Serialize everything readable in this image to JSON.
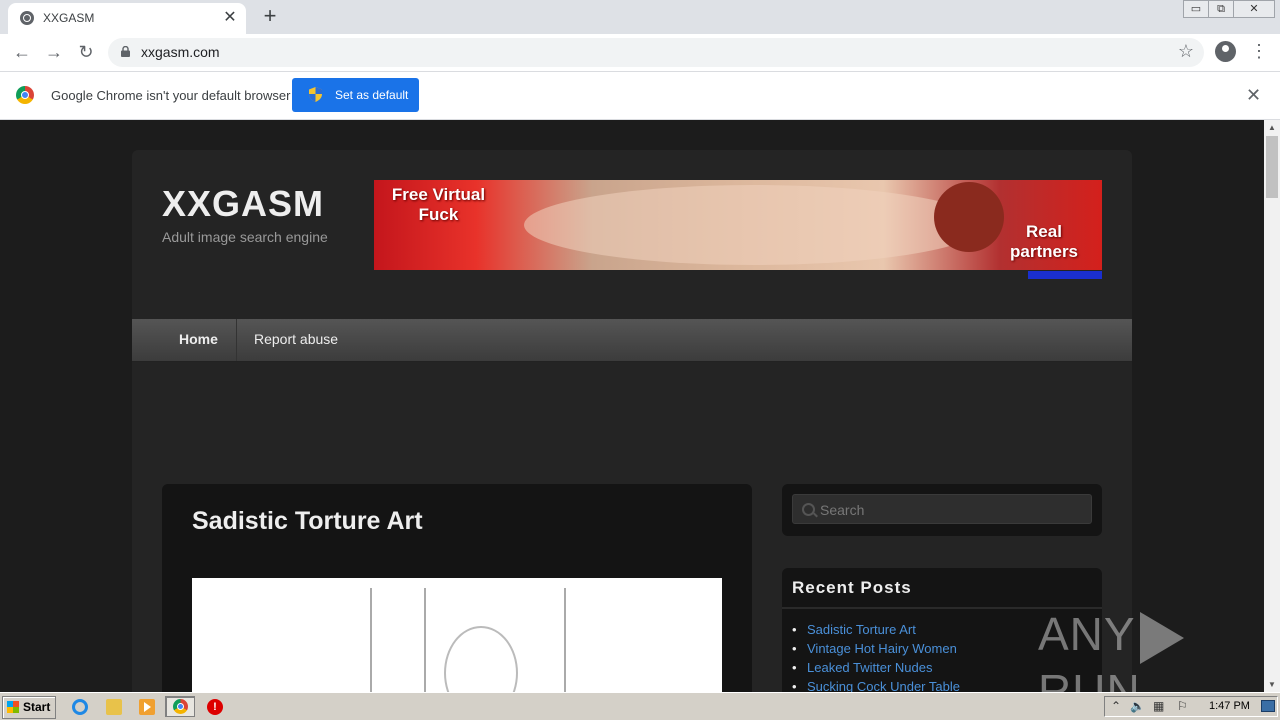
{
  "browser": {
    "tab_title": "XXGASM",
    "tab_close": "✕",
    "new_tab": "+",
    "url": "xxgasm.com",
    "window_controls": [
      "▭",
      "⧉",
      "✕"
    ]
  },
  "infobar": {
    "message": "Google Chrome isn't your default browser",
    "button_label": "Set as default",
    "close": "✕"
  },
  "site": {
    "title": "XXGASM",
    "description": "Adult image search engine",
    "banner": {
      "left_text": "Free Virtual Fuck",
      "right_text": "Real partners"
    },
    "nav": [
      "Home",
      "Report abuse"
    ],
    "post_title": "Sadistic Torture Art",
    "search_placeholder": "Search",
    "recent_posts_heading": "Recent Posts",
    "recent_posts": [
      "Sadistic Torture Art",
      "Vintage Hot Hairy Women",
      "Leaked Twitter Nudes",
      "Sucking Cock Under Table"
    ]
  },
  "watermark": {
    "left": "ANY",
    "right": "RUN"
  },
  "taskbar": {
    "start_label": "Start",
    "clock": "1:47 PM"
  },
  "colors": {
    "accent_blue": "#1a73e8",
    "link_blue": "#4a90d9",
    "page_bg": "#1c1c1c"
  }
}
